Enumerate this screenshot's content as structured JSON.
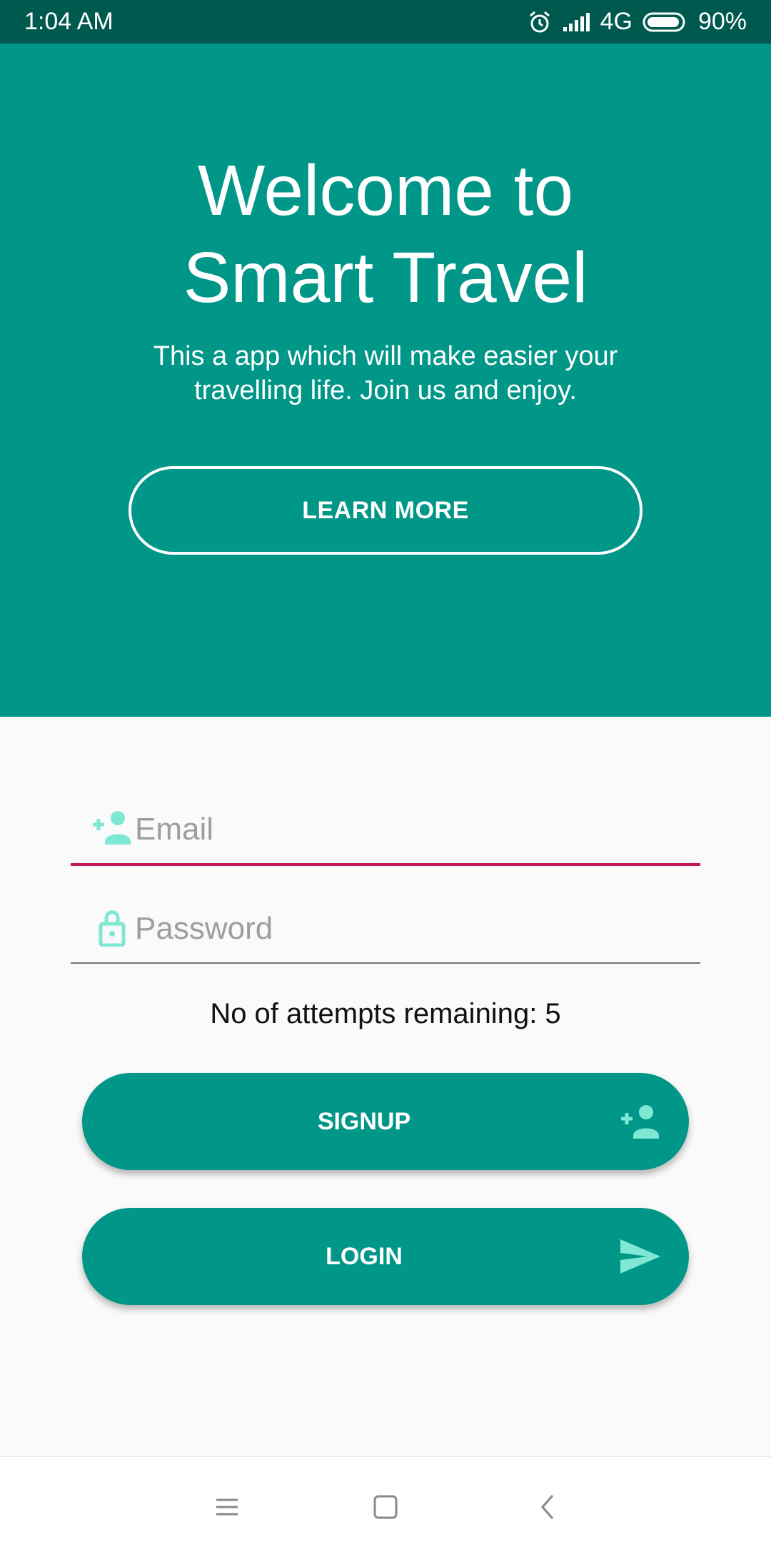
{
  "status_bar": {
    "time": "1:04  AM",
    "network": "4G",
    "battery": "90%",
    "icons": [
      "alarm-icon",
      "signal-icon",
      "battery-icon"
    ]
  },
  "hero": {
    "title_line1": "Welcome to",
    "title_line2": "Smart Travel",
    "subtitle": "This a app which will make easier your travelling life. Join us and enjoy.",
    "learn_more_label": "LEARN MORE",
    "background_color": "#009688"
  },
  "form": {
    "email": {
      "placeholder": "Email",
      "value": "",
      "icon": "add-person-icon"
    },
    "password": {
      "placeholder": "Password",
      "value": "",
      "icon": "lock-icon"
    },
    "attempts_text": "No of attempts remaining: 5"
  },
  "buttons": {
    "signup_label": "SIGNUP",
    "signup_icon": "add-person-icon",
    "login_label": "LOGIN",
    "login_icon": "send-icon"
  },
  "nav_bar": {
    "icons": [
      "menu-icon",
      "home-icon",
      "back-icon"
    ]
  },
  "colors": {
    "accent": "#009688",
    "status_bar": "#00594f",
    "icon_tint": "#7ee8d4",
    "focused_underline": "#c2185b"
  }
}
